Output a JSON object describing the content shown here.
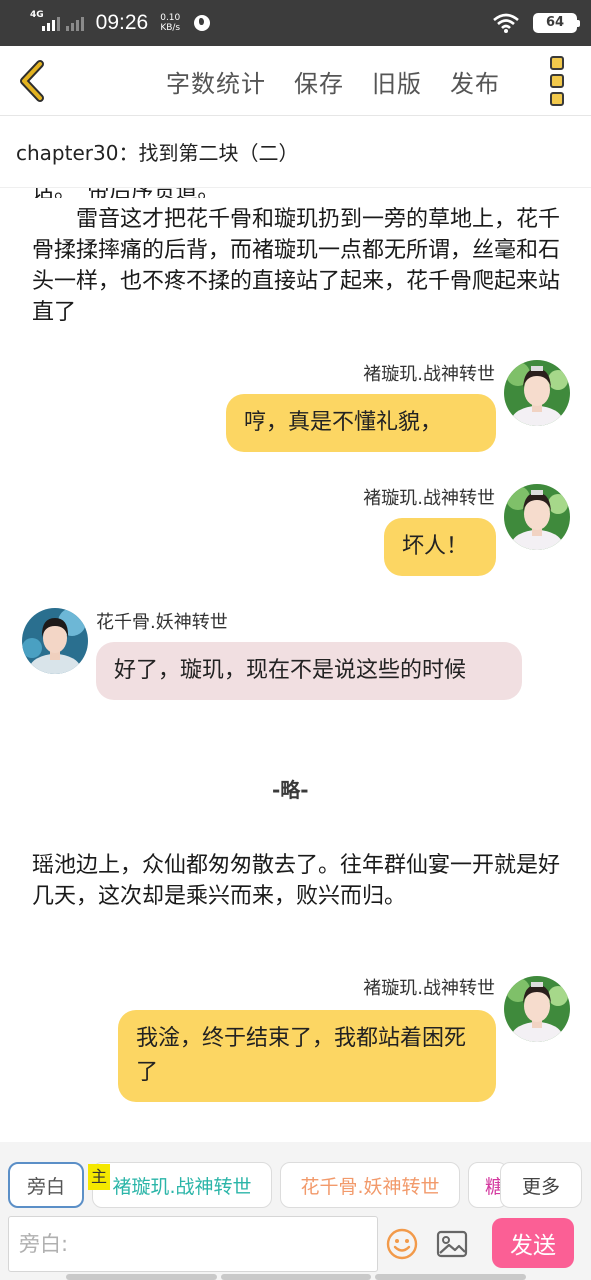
{
  "status_bar": {
    "network": "4G",
    "time": "09:26",
    "speed_value": "0.10",
    "speed_unit": "KB/s",
    "battery": "64"
  },
  "toolbar": {
    "back_icon": "chevron-left-icon",
    "word_count_label": "字数统计",
    "save_label": "保存",
    "old_version_label": "旧版",
    "publish_label": "发布",
    "menu_icon": "more-vertical-icon"
  },
  "chapter": {
    "title": "chapter30：找到第二块（二）"
  },
  "story": {
    "partial_top": "话。“帝后序贯道。",
    "narration_1": "　　雷音这才把花千骨和璇玑扔到一旁的草地上，花千骨揉揉摔痛的后背，而褚璇玑一点都无所谓，丝毫和石头一样，也不疼不揉的直接站了起来，花千骨爬起来站直了",
    "messages": [
      {
        "sender": "褚璇玑.战神转世",
        "text": "哼，真是不懂礼貌，",
        "side": "right"
      },
      {
        "sender": "褚璇玑.战神转世",
        "text": "坏人！",
        "side": "right"
      },
      {
        "sender": "花千骨.妖神转世",
        "text": "好了，璇玑，现在不是说这些的时候",
        "side": "left"
      }
    ],
    "omit_marker": "-略-",
    "narration_2": "瑶池边上，众仙都匆匆散去了。往年群仙宴一开就是好几天，这次却是乘兴而来，败兴而归。",
    "message_4": {
      "sender": "褚璇玑.战神转世",
      "text": "我淦，终于结束了，我都站着困死了",
      "side": "right"
    }
  },
  "role_bar": {
    "narration_chip": "旁白",
    "main_tag": "主",
    "chip_xuanji": "褚璇玑.战神转世",
    "chip_qiangu": "花千骨.妖神转世",
    "chip_partial": "糖",
    "more_label": "更多"
  },
  "composer": {
    "placeholder": "旁白:",
    "emoji_icon": "smiley-icon",
    "image_icon": "image-icon",
    "send_label": "发送"
  },
  "colors": {
    "yellow_bubble": "#fcd663",
    "pink_bubble": "#f1dfe1",
    "send_button": "#fb5f95",
    "chip_teal": "#2bb5a8",
    "chip_orange": "#f29a6b",
    "chip_magenta": "#d43aa0",
    "back_icon": "#d9a100"
  }
}
